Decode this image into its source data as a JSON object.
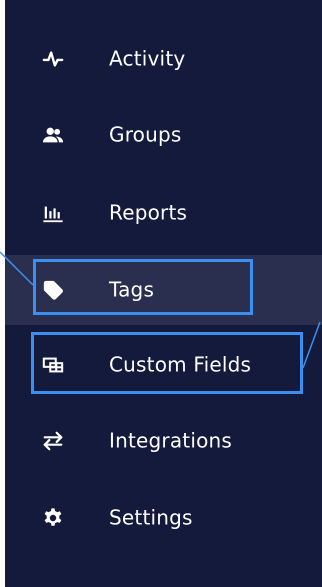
{
  "sidebar": {
    "items": [
      {
        "label": "Activity",
        "icon": "activity-icon",
        "active": false
      },
      {
        "label": "Groups",
        "icon": "groups-icon",
        "active": false
      },
      {
        "label": "Reports",
        "icon": "reports-icon",
        "active": false
      },
      {
        "label": "Tags",
        "icon": "tag-icon",
        "active": true
      },
      {
        "label": "Custom Fields",
        "icon": "custom-fields-icon",
        "active": false
      },
      {
        "label": "Integrations",
        "icon": "integrations-icon",
        "active": false
      },
      {
        "label": "Settings",
        "icon": "gear-icon",
        "active": false
      }
    ]
  },
  "colors": {
    "sidebar_bg": "#141a3c",
    "active_bg": "#2a2f4f",
    "text": "#ffffff",
    "highlight": "#3b8ff0"
  }
}
